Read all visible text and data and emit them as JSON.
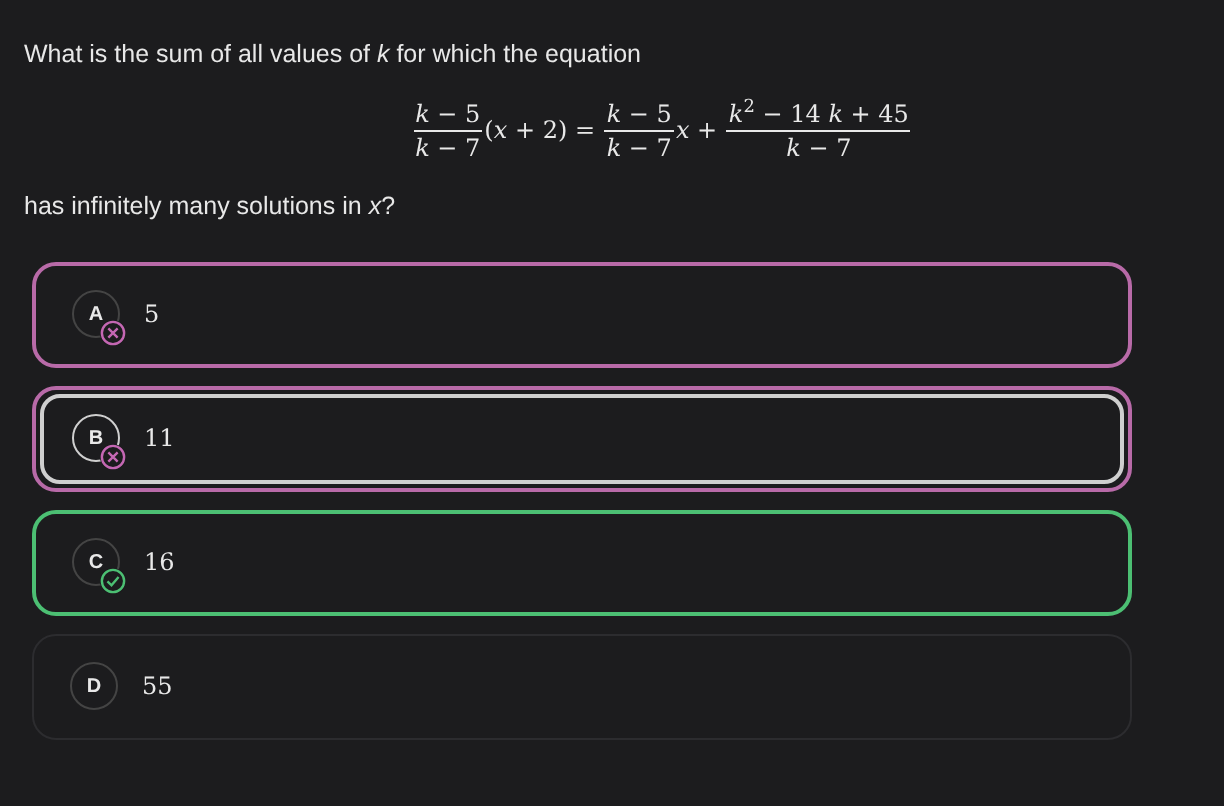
{
  "question": {
    "intro": "What is the sum of all values of *k* for which the equation",
    "equation": [
      {
        "kind": "fraction",
        "numerator": "*k* − 5",
        "denominator": "*k* − 7"
      },
      {
        "kind": "text",
        "text": "(*x* + 2) = "
      },
      {
        "kind": "fraction",
        "numerator": "*k* − 5",
        "denominator": "*k* − 7"
      },
      {
        "kind": "text",
        "text": "*x* + "
      },
      {
        "kind": "fraction",
        "numerator": "*k*$^{2}$ − 14 *k* + 45",
        "denominator": "*k* − 7"
      }
    ],
    "outro": "has infinitely many solutions in *x*?"
  },
  "options": [
    {
      "letter": "A",
      "text": "5",
      "selected": false,
      "kind": "wrong"
    },
    {
      "letter": "B",
      "text": "11",
      "selected": true,
      "kind": "wrong"
    },
    {
      "letter": "C",
      "text": "16",
      "selected": false,
      "kind": "correct"
    },
    {
      "letter": "D",
      "text": "55",
      "selected": false,
      "kind": "plain"
    }
  ]
}
